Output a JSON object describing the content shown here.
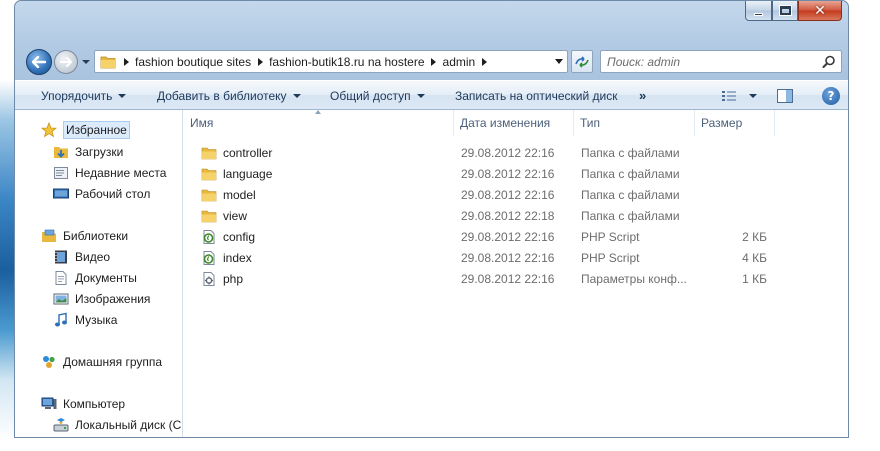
{
  "window": {
    "caption_buttons": {
      "minimize_icon": "minimize-icon",
      "maximize_icon": "maximize-icon",
      "close_glyph": "✕"
    }
  },
  "navigation": {
    "breadcrumbs": [
      "fashion boutique sites",
      "fashion-butik18.ru na hostere",
      "admin"
    ],
    "search_placeholder": "Поиск: admin"
  },
  "command_bar": {
    "organize": "Упорядочить",
    "add_to_library": "Добавить в библиотеку",
    "share": "Общий доступ",
    "burn": "Записать на оптический диск",
    "more": "»"
  },
  "sidebar": {
    "favorites": "Избранное",
    "favorites_items": [
      "Загрузки",
      "Недавние места",
      "Рабочий стол"
    ],
    "libraries": "Библиотеки",
    "libraries_items": [
      "Видео",
      "Документы",
      "Изображения",
      "Музыка"
    ],
    "homegroup": "Домашняя группа",
    "computer": "Компьютер",
    "computer_items": [
      "Локальный диск (C"
    ]
  },
  "columns": {
    "name": "Имя",
    "date": "Дата изменения",
    "type": "Тип",
    "size": "Размер"
  },
  "files": [
    {
      "name": "controller",
      "date": "29.08.2012 22:16",
      "type": "Папка с файлами",
      "size": "",
      "icon": "folder-icon"
    },
    {
      "name": "language",
      "date": "29.08.2012 22:16",
      "type": "Папка с файлами",
      "size": "",
      "icon": "folder-icon"
    },
    {
      "name": "model",
      "date": "29.08.2012 22:16",
      "type": "Папка с файлами",
      "size": "",
      "icon": "folder-icon"
    },
    {
      "name": "view",
      "date": "29.08.2012 22:18",
      "type": "Папка с файлами",
      "size": "",
      "icon": "folder-icon"
    },
    {
      "name": "config",
      "date": "29.08.2012 22:16",
      "type": "PHP Script",
      "size": "2 КБ",
      "icon": "php-script-icon"
    },
    {
      "name": "index",
      "date": "29.08.2012 22:16",
      "type": "PHP Script",
      "size": "4 КБ",
      "icon": "php-script-icon"
    },
    {
      "name": "php",
      "date": "29.08.2012 22:16",
      "type": "Параметры конф...",
      "size": "1 КБ",
      "icon": "config-file-icon"
    }
  ],
  "colors": {
    "accent": "#1f5ca3",
    "close_red": "#c3391c",
    "folder_yellow": "#e8b93c",
    "selection": "#dcebfb"
  }
}
